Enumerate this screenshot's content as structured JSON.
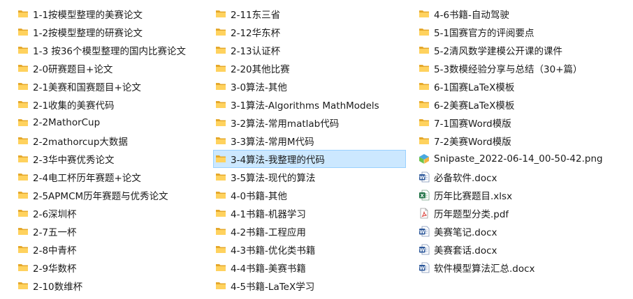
{
  "columns": [
    [
      {
        "name": "1-1按模型整理的美赛论文",
        "type": "folder"
      },
      {
        "name": "1-2按模型整理的研赛论文",
        "type": "folder"
      },
      {
        "name": "1-3 按36个模型整理的国内比赛论文",
        "type": "folder"
      },
      {
        "name": "2-0研赛题目+论文",
        "type": "folder"
      },
      {
        "name": "2-1美赛和国赛题目+论文",
        "type": "folder"
      },
      {
        "name": "2-1收集的美赛代码",
        "type": "folder"
      },
      {
        "name": "2-2MathorCup",
        "type": "folder"
      },
      {
        "name": "2-2mathorcup大数据",
        "type": "folder"
      },
      {
        "name": "2-3华中赛优秀论文",
        "type": "folder"
      },
      {
        "name": "2-4电工杯历年赛题+论文",
        "type": "folder"
      },
      {
        "name": "2-5APMCM历年赛题与优秀论文",
        "type": "folder"
      },
      {
        "name": "2-6深圳杯",
        "type": "folder"
      },
      {
        "name": "2-7五一杯",
        "type": "folder"
      },
      {
        "name": "2-8中青杯",
        "type": "folder"
      },
      {
        "name": "2-9华数杯",
        "type": "folder"
      },
      {
        "name": "2-10数维杯",
        "type": "folder"
      }
    ],
    [
      {
        "name": "2-11东三省",
        "type": "folder"
      },
      {
        "name": "2-12华东杯",
        "type": "folder"
      },
      {
        "name": "2-13认证杯",
        "type": "folder"
      },
      {
        "name": "2-20其他比赛",
        "type": "folder"
      },
      {
        "name": "3-0算法-其他",
        "type": "folder"
      },
      {
        "name": "3-1算法-Algorithms  MathModels",
        "type": "folder"
      },
      {
        "name": "3-2算法-常用matlab代码",
        "type": "folder"
      },
      {
        "name": "3-3算法-常用M代码",
        "type": "folder"
      },
      {
        "name": "3-4算法-我整理的代码",
        "type": "folder",
        "selected": true
      },
      {
        "name": "3-5算法-现代的算法",
        "type": "folder"
      },
      {
        "name": "4-0书籍-其他",
        "type": "folder"
      },
      {
        "name": "4-1书籍-机器学习",
        "type": "folder"
      },
      {
        "name": "4-2书籍-工程应用",
        "type": "folder"
      },
      {
        "name": "4-3书籍-优化类书籍",
        "type": "folder"
      },
      {
        "name": "4-4书籍-美赛书籍",
        "type": "folder"
      },
      {
        "name": "4-5书籍-LaTeX学习",
        "type": "folder"
      }
    ],
    [
      {
        "name": "4-6书籍-自动驾驶",
        "type": "folder"
      },
      {
        "name": "5-1国赛官方的评阅要点",
        "type": "folder"
      },
      {
        "name": "5-2清风数学建模公开课的课件",
        "type": "folder"
      },
      {
        "name": "5-3数模经验分享与总结（30+篇）",
        "type": "folder"
      },
      {
        "name": "6-1国赛LaTeX模板",
        "type": "folder"
      },
      {
        "name": "6-2美赛LaTeX模板",
        "type": "folder"
      },
      {
        "name": "7-1国赛Word模版",
        "type": "folder"
      },
      {
        "name": "7-2美赛Word模版",
        "type": "folder"
      },
      {
        "name": "Snipaste_2022-06-14_00-50-42.png",
        "type": "png"
      },
      {
        "name": "必备软件.docx",
        "type": "docx"
      },
      {
        "name": "历年比赛题目.xlsx",
        "type": "xlsx"
      },
      {
        "name": "历年题型分类.pdf",
        "type": "pdf"
      },
      {
        "name": "美赛笔记.docx",
        "type": "docx"
      },
      {
        "name": "美赛套话.docx",
        "type": "docx"
      },
      {
        "name": "软件模型算法汇总.docx",
        "type": "docx"
      }
    ]
  ],
  "colors": {
    "folder_back": "#e5a82b",
    "folder_front": "#ffd25e",
    "selection_bg": "#cce8ff",
    "selection_border": "#99d1ff",
    "word": "#2b579a",
    "excel": "#217346",
    "pdf": "#d93831"
  }
}
